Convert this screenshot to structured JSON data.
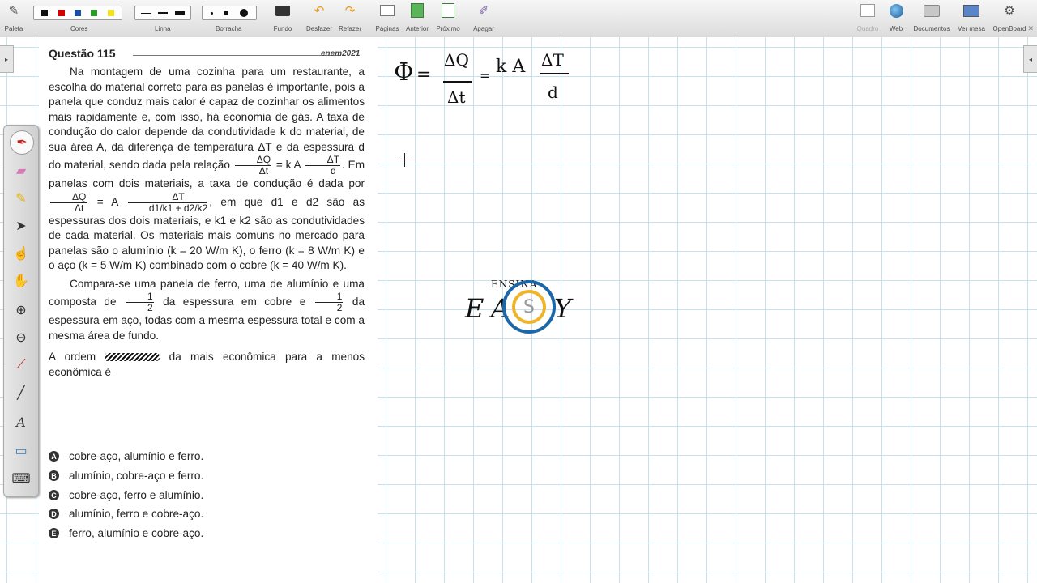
{
  "toolbar": {
    "palette": "Paleta",
    "colors": "Cores",
    "line": "Linha",
    "eraser": "Borracha",
    "background": "Fundo",
    "undo": "Desfazer",
    "redo": "Refazer",
    "pages": "Páginas",
    "previous": "Anterior",
    "next": "Próximo",
    "delete": "Apagar",
    "board": "Quadro",
    "web": "Web",
    "documents": "Documentos",
    "desktop": "Ver mesa",
    "openboard": "OpenBoard",
    "color_swatches": [
      "#111111",
      "#d40000",
      "#1f4e9c",
      "#2a9a2a",
      "#f3e21c"
    ]
  },
  "question": {
    "title": "Questão 115",
    "exam": "enem2021",
    "p1a": "Na montagem de uma cozinha para um restaurante, a escolha do material correto para as panelas é importante, pois a panela que conduz mais calor é capaz de cozinhar os alimentos mais rapidamente e, com isso, há economia de gás. A taxa de condução do calor depende da condutividade k do material, de sua área A, da diferença de temperatura ΔT e da espessura d do material, sendo dada pela relação",
    "eq1_num": "ΔQ",
    "eq1_den": "Δt",
    "eq1_mid": "= k A",
    "eq1_num2": "ΔT",
    "eq1_den2": "d",
    "p1b": ". Em panelas com dois materiais, a taxa de condução é dada por",
    "eq2_mid": "= A",
    "eq2_den": "d1/k1 + d2/k2",
    "p1c": ", em que d1 e d2 são as espessuras dos dois materiais, e k1 e k2 são as condutividades de cada material. Os materiais mais comuns no mercado para panelas são o alumínio (k = 20 W/m K), o ferro (k = 8 W/m K) e o aço (k = 5 W/m K) combinado com o cobre (k = 40 W/m K).",
    "p2a": "Compara-se uma panela de ferro, uma de alumínio e uma composta de",
    "half": "1",
    "half_den": "2",
    "p2b": "da espessura em cobre e",
    "p2c": "da espessura em aço, todas com a mesma espessura total e com a mesma área de fundo.",
    "p3a": "A ordem",
    "p3b": "da mais econômica para a menos econômica é",
    "options": [
      {
        "letter": "A",
        "text": "cobre-aço, alumínio e ferro."
      },
      {
        "letter": "B",
        "text": "alumínio, cobre-aço e ferro."
      },
      {
        "letter": "C",
        "text": "cobre-aço, ferro e alumínio."
      },
      {
        "letter": "D",
        "text": "alumínio, ferro e cobre-aço."
      },
      {
        "letter": "E",
        "text": "ferro, alumínio e cobre-aço."
      }
    ]
  },
  "handwriting": {
    "phi": "Φ",
    "eq": "=",
    "num1": "ΔQ",
    "den1": "Δt",
    "eq2": "=",
    "ka": "k A",
    "num2": "ΔT",
    "den2": "d"
  },
  "logo": {
    "top": "ENSINA",
    "left": "E",
    "mid": "A",
    "right": "Y",
    "center": "S"
  }
}
